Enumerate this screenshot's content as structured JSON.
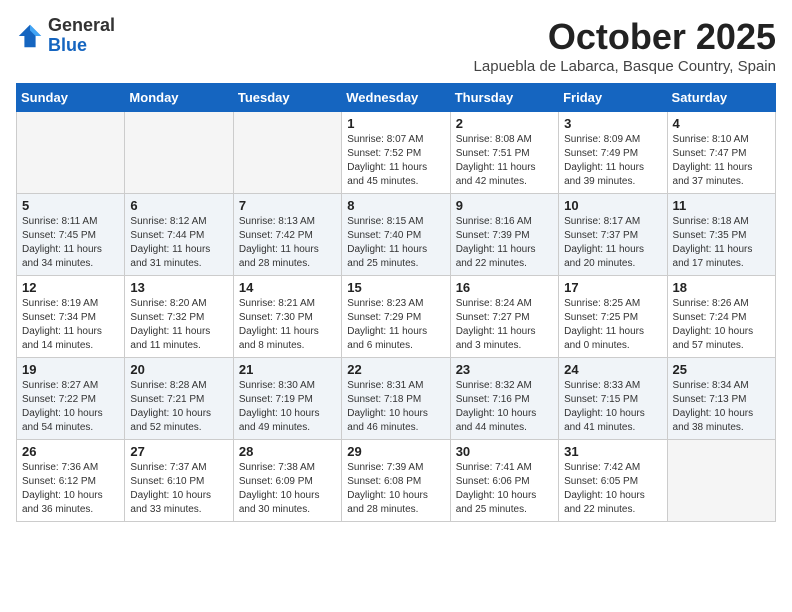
{
  "header": {
    "logo_general": "General",
    "logo_blue": "Blue",
    "month": "October 2025",
    "location": "Lapuebla de Labarca, Basque Country, Spain"
  },
  "days_of_week": [
    "Sunday",
    "Monday",
    "Tuesday",
    "Wednesday",
    "Thursday",
    "Friday",
    "Saturday"
  ],
  "weeks": [
    [
      {
        "day": "",
        "info": ""
      },
      {
        "day": "",
        "info": ""
      },
      {
        "day": "",
        "info": ""
      },
      {
        "day": "1",
        "info": "Sunrise: 8:07 AM\nSunset: 7:52 PM\nDaylight: 11 hours and 45 minutes."
      },
      {
        "day": "2",
        "info": "Sunrise: 8:08 AM\nSunset: 7:51 PM\nDaylight: 11 hours and 42 minutes."
      },
      {
        "day": "3",
        "info": "Sunrise: 8:09 AM\nSunset: 7:49 PM\nDaylight: 11 hours and 39 minutes."
      },
      {
        "day": "4",
        "info": "Sunrise: 8:10 AM\nSunset: 7:47 PM\nDaylight: 11 hours and 37 minutes."
      }
    ],
    [
      {
        "day": "5",
        "info": "Sunrise: 8:11 AM\nSunset: 7:45 PM\nDaylight: 11 hours and 34 minutes."
      },
      {
        "day": "6",
        "info": "Sunrise: 8:12 AM\nSunset: 7:44 PM\nDaylight: 11 hours and 31 minutes."
      },
      {
        "day": "7",
        "info": "Sunrise: 8:13 AM\nSunset: 7:42 PM\nDaylight: 11 hours and 28 minutes."
      },
      {
        "day": "8",
        "info": "Sunrise: 8:15 AM\nSunset: 7:40 PM\nDaylight: 11 hours and 25 minutes."
      },
      {
        "day": "9",
        "info": "Sunrise: 8:16 AM\nSunset: 7:39 PM\nDaylight: 11 hours and 22 minutes."
      },
      {
        "day": "10",
        "info": "Sunrise: 8:17 AM\nSunset: 7:37 PM\nDaylight: 11 hours and 20 minutes."
      },
      {
        "day": "11",
        "info": "Sunrise: 8:18 AM\nSunset: 7:35 PM\nDaylight: 11 hours and 17 minutes."
      }
    ],
    [
      {
        "day": "12",
        "info": "Sunrise: 8:19 AM\nSunset: 7:34 PM\nDaylight: 11 hours and 14 minutes."
      },
      {
        "day": "13",
        "info": "Sunrise: 8:20 AM\nSunset: 7:32 PM\nDaylight: 11 hours and 11 minutes."
      },
      {
        "day": "14",
        "info": "Sunrise: 8:21 AM\nSunset: 7:30 PM\nDaylight: 11 hours and 8 minutes."
      },
      {
        "day": "15",
        "info": "Sunrise: 8:23 AM\nSunset: 7:29 PM\nDaylight: 11 hours and 6 minutes."
      },
      {
        "day": "16",
        "info": "Sunrise: 8:24 AM\nSunset: 7:27 PM\nDaylight: 11 hours and 3 minutes."
      },
      {
        "day": "17",
        "info": "Sunrise: 8:25 AM\nSunset: 7:25 PM\nDaylight: 11 hours and 0 minutes."
      },
      {
        "day": "18",
        "info": "Sunrise: 8:26 AM\nSunset: 7:24 PM\nDaylight: 10 hours and 57 minutes."
      }
    ],
    [
      {
        "day": "19",
        "info": "Sunrise: 8:27 AM\nSunset: 7:22 PM\nDaylight: 10 hours and 54 minutes."
      },
      {
        "day": "20",
        "info": "Sunrise: 8:28 AM\nSunset: 7:21 PM\nDaylight: 10 hours and 52 minutes."
      },
      {
        "day": "21",
        "info": "Sunrise: 8:30 AM\nSunset: 7:19 PM\nDaylight: 10 hours and 49 minutes."
      },
      {
        "day": "22",
        "info": "Sunrise: 8:31 AM\nSunset: 7:18 PM\nDaylight: 10 hours and 46 minutes."
      },
      {
        "day": "23",
        "info": "Sunrise: 8:32 AM\nSunset: 7:16 PM\nDaylight: 10 hours and 44 minutes."
      },
      {
        "day": "24",
        "info": "Sunrise: 8:33 AM\nSunset: 7:15 PM\nDaylight: 10 hours and 41 minutes."
      },
      {
        "day": "25",
        "info": "Sunrise: 8:34 AM\nSunset: 7:13 PM\nDaylight: 10 hours and 38 minutes."
      }
    ],
    [
      {
        "day": "26",
        "info": "Sunrise: 7:36 AM\nSunset: 6:12 PM\nDaylight: 10 hours and 36 minutes."
      },
      {
        "day": "27",
        "info": "Sunrise: 7:37 AM\nSunset: 6:10 PM\nDaylight: 10 hours and 33 minutes."
      },
      {
        "day": "28",
        "info": "Sunrise: 7:38 AM\nSunset: 6:09 PM\nDaylight: 10 hours and 30 minutes."
      },
      {
        "day": "29",
        "info": "Sunrise: 7:39 AM\nSunset: 6:08 PM\nDaylight: 10 hours and 28 minutes."
      },
      {
        "day": "30",
        "info": "Sunrise: 7:41 AM\nSunset: 6:06 PM\nDaylight: 10 hours and 25 minutes."
      },
      {
        "day": "31",
        "info": "Sunrise: 7:42 AM\nSunset: 6:05 PM\nDaylight: 10 hours and 22 minutes."
      },
      {
        "day": "",
        "info": ""
      }
    ]
  ]
}
